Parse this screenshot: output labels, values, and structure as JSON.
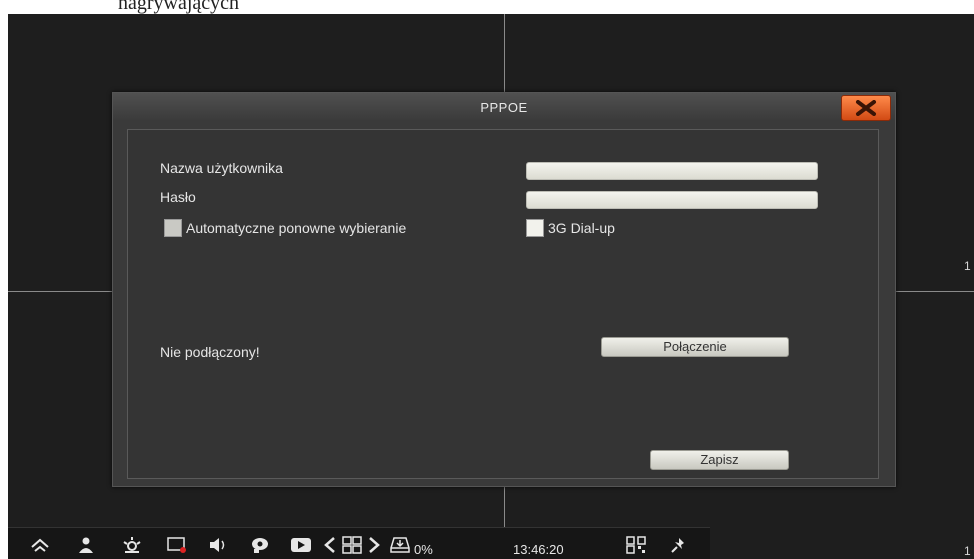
{
  "top_text": "nagrywających",
  "screen": {
    "channel_numbers": [
      "1",
      "1"
    ]
  },
  "dialog": {
    "title": "PPPOE",
    "close_icon": "close-x-icon",
    "close_color": "#e85a1c",
    "username_label": "Nazwa użytkownika",
    "username_value": "",
    "password_label": "Hasło",
    "password_value": "",
    "auto_redial_label": "Automatyczne ponowne wybieranie",
    "auto_redial_checked": false,
    "dialup_3g_label": "3G Dial-up",
    "dialup_3g_checked": false,
    "status": "Nie podłączony!",
    "connect_label": "Połączenie",
    "save_label": "Zapisz"
  },
  "taskbar": {
    "icons": [
      "home-up-icon",
      "user-icon",
      "motion-alarm-icon",
      "record-icon",
      "volume-icon",
      "ptz-icon",
      "playback-icon",
      "prev-arrow-icon",
      "grid-layout-icon",
      "next-arrow-icon",
      "hdd-icon",
      "qr-code-icon",
      "pin-icon"
    ],
    "hdd_usage": "0%",
    "time": "13:46:20"
  }
}
